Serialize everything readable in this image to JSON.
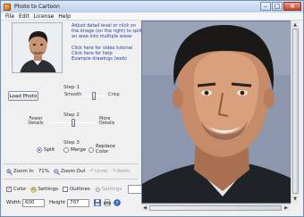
{
  "window": {
    "title": "Photo to Cartoon"
  },
  "menu": [
    "File",
    "Edit",
    "License",
    "Help"
  ],
  "instructions": "Adjust detail level or click on the image (on the right) to split an area into multiple areas",
  "links": {
    "video": "Click here for video tutorial",
    "help": "Click here for help",
    "examples": "Example drawings (web)"
  },
  "step1": {
    "title": "Step 1",
    "load_label": "Load Photo",
    "smooth_label": "Smooth",
    "crisp_label": "Crisp",
    "smooth_level": 0.45
  },
  "step2": {
    "title": "Step 2",
    "fewer_label": "Fewer Details",
    "more_label": "More Details",
    "detail_level": 0.5
  },
  "step3": {
    "title": "Step 3",
    "options": [
      {
        "label": "Split",
        "selected": true
      },
      {
        "label": "Merge",
        "selected": false
      },
      {
        "label": "Replace Color",
        "selected": false
      }
    ]
  },
  "toolbar": {
    "zoom_in": "Zoom In",
    "zoom_value": "71%",
    "zoom_out": "Zoom Out",
    "undo": "Undo",
    "redo": "Redo"
  },
  "options": {
    "color_label": "Color",
    "color_checked": true,
    "settings1": "Settings",
    "outlines_label": "Outlines",
    "outlines_checked": false,
    "settings2": "Settings"
  },
  "size": {
    "width_label": "Width",
    "width_value": "600",
    "height_label": "Height",
    "height_value": "707"
  },
  "colors": {
    "accent": "#1f57b5",
    "link": "#1f3f9f",
    "preview_bg": "#8b96ad"
  }
}
